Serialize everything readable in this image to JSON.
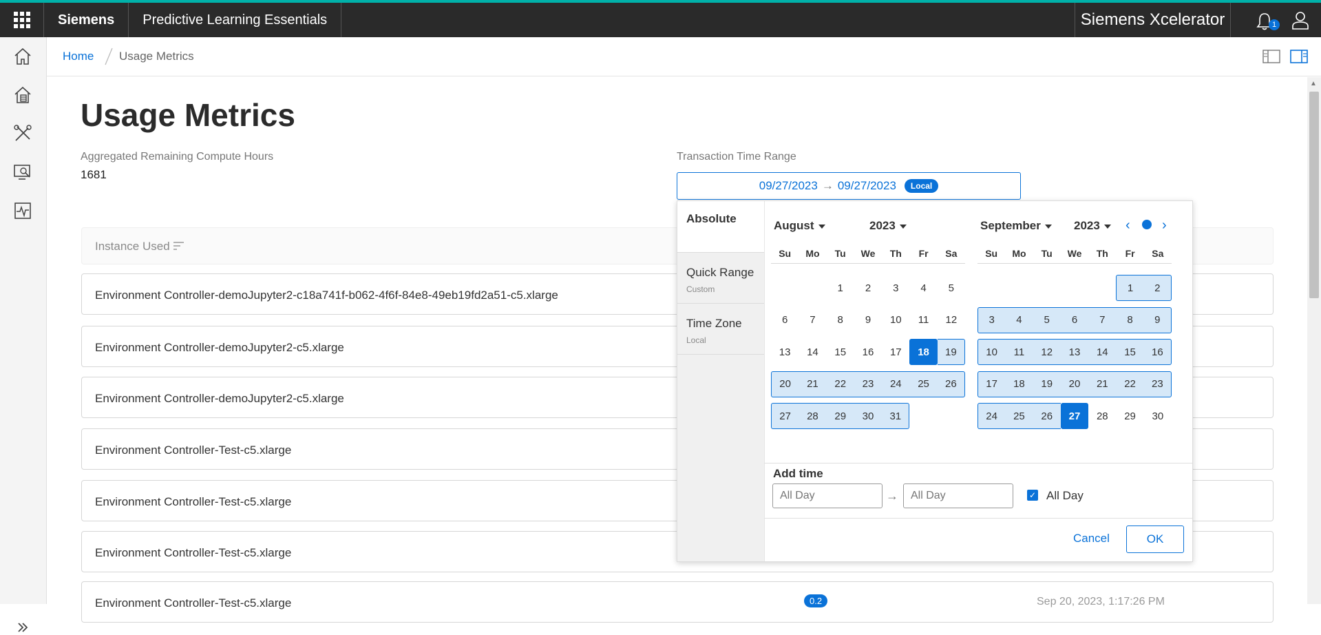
{
  "topbar": {
    "brand": "Siemens",
    "app_name": "Predictive Learning Essentials",
    "platform": "Siemens Xcelerator",
    "notification_count": "1"
  },
  "breadcrumb": {
    "home": "Home",
    "current": "Usage Metrics"
  },
  "page": {
    "title": "Usage Metrics",
    "compute_label": "Aggregated Remaining Compute Hours",
    "compute_value": "1681",
    "range_label": "Transaction Time Range",
    "range_start": "09/27/2023",
    "range_end": "09/27/2023",
    "range_tz": "Local"
  },
  "table": {
    "sort_header": "Instance Used",
    "rows": [
      "Environment Controller-demoJupyter2-c18a741f-b062-4f6f-84e8-49eb19fd2a51-c5.xlarge",
      "Environment Controller-demoJupyter2-c5.xlarge",
      "Environment Controller-demoJupyter2-c5.xlarge",
      "Environment Controller-Test-c5.xlarge",
      "Environment Controller-Test-c5.xlarge",
      "Environment Controller-Test-c5.xlarge",
      "Environment Controller-Test-c5.xlarge"
    ],
    "partial_badge": "0.2",
    "partial_time": "Sep 20, 2023, 1:17:26 PM"
  },
  "picker": {
    "side": {
      "absolute": "Absolute",
      "quick_range": "Quick Range",
      "quick_range_sub": "Custom",
      "time_zone": "Time Zone",
      "time_zone_sub": "Local"
    },
    "weekdays": [
      "Su",
      "Mo",
      "Tu",
      "We",
      "Th",
      "Fr",
      "Sa"
    ],
    "left": {
      "month": "August",
      "year": "2023"
    },
    "right": {
      "month": "September",
      "year": "2023"
    },
    "add_time": "Add time",
    "time_from_placeholder": "All Day",
    "time_to_placeholder": "All Day",
    "all_day": "All Day",
    "cancel": "Cancel",
    "ok": "OK"
  },
  "colors": {
    "accent": "#0a72d8",
    "topbar": "#2a2a2a",
    "teal": "#00b1a9"
  }
}
